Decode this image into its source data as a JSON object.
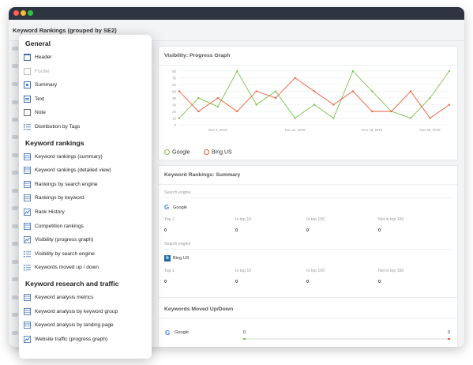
{
  "window": {
    "title": "Keyword Rankings (grouped by SE2)"
  },
  "colors": {
    "titlebar": "#2e3440",
    "dot_red": "#ff5f57",
    "dot_yellow": "#febc2e",
    "dot_green": "#28c840",
    "google": "#7ac143",
    "bing": "#ea5a36",
    "accent": "#3a6fb5"
  },
  "menu": {
    "sections": [
      {
        "title": "General",
        "items": [
          {
            "label": "Header",
            "icon": "header-icon"
          },
          {
            "label": "Footer",
            "icon": "footer-icon",
            "disabled": true
          },
          {
            "label": "Summary",
            "icon": "summary-icon"
          },
          {
            "label": "Text",
            "icon": "text-icon"
          },
          {
            "label": "Note",
            "icon": "note-icon"
          },
          {
            "label": "Distribution by Tags",
            "icon": "list-icon"
          }
        ]
      },
      {
        "title": "Keyword rankings",
        "items": [
          {
            "label": "Keyword rankings (summary)",
            "icon": "table-icon"
          },
          {
            "label": "Keyword rankings (detailed view)",
            "icon": "table-icon"
          },
          {
            "label": "Rankings by search engine",
            "icon": "table-icon"
          },
          {
            "label": "Rankings by keyword",
            "icon": "table-icon"
          },
          {
            "label": "Rank History",
            "icon": "line-chart-icon"
          },
          {
            "label": "Competition rankings",
            "icon": "table-icon"
          },
          {
            "label": "Visibility (progress graph)",
            "icon": "line-chart-icon"
          },
          {
            "label": "Visibility by search engine",
            "icon": "list-icon"
          },
          {
            "label": "Keywords moved up / down",
            "icon": "list-icon"
          }
        ]
      },
      {
        "title": "Keyword research and traffic",
        "items": [
          {
            "label": "Keyword analysis metrics",
            "icon": "table-icon"
          },
          {
            "label": "Keyword analysis by keyword group",
            "icon": "table-icon"
          },
          {
            "label": "Keyword analysis by landing page",
            "icon": "table-icon"
          },
          {
            "label": "Website traffic (progress graph)",
            "icon": "line-chart-icon"
          }
        ]
      }
    ]
  },
  "visibility_panel": {
    "title": "Visibility: Progress Graph",
    "legend": [
      "Google",
      "Bing US"
    ]
  },
  "chart_data": {
    "type": "line",
    "title": "Visibility: Progress Graph",
    "xlabel": "",
    "ylabel": "",
    "ylim": [
      0,
      80
    ],
    "yticks": [
      "80",
      "70",
      "60",
      "50",
      "40",
      "30",
      "20",
      "10",
      "0"
    ],
    "xticks": [
      "Nov 4, 2019",
      "Nov 11, 2019",
      "Nov 18, 2019",
      "Nov 25, 2019"
    ],
    "grid": true,
    "legend_position": "bottom-left",
    "series": [
      {
        "name": "Google",
        "color": "#7ac143",
        "values": [
          10,
          40,
          27,
          80,
          30,
          50,
          10,
          30,
          10,
          80,
          50,
          20,
          10,
          40,
          80
        ]
      },
      {
        "name": "Bing US",
        "color": "#ea5a36",
        "values": [
          50,
          20,
          40,
          20,
          50,
          40,
          70,
          50,
          30,
          50,
          20,
          20,
          50,
          10,
          30
        ]
      }
    ]
  },
  "summary_panel": {
    "title": "Keyword Rankings: Summary",
    "engines": [
      {
        "section_label": "Search engine",
        "name": "Google",
        "columns": [
          "Top 1",
          "In top 10",
          "In top 100",
          "Not in top 100"
        ],
        "values": [
          "0",
          "0",
          "0",
          "0"
        ]
      },
      {
        "section_label": "Search engine",
        "name": "Bing US",
        "columns": [
          "Top 1",
          "In top 10",
          "In top 100",
          "Not in top 100"
        ],
        "values": [
          "0",
          "0",
          "0",
          "0"
        ]
      }
    ]
  },
  "moved_panel": {
    "title": "Keywords Moved Up/Down",
    "rows": [
      {
        "engine": "Google",
        "left_value": "0",
        "right_value": "0"
      }
    ]
  }
}
